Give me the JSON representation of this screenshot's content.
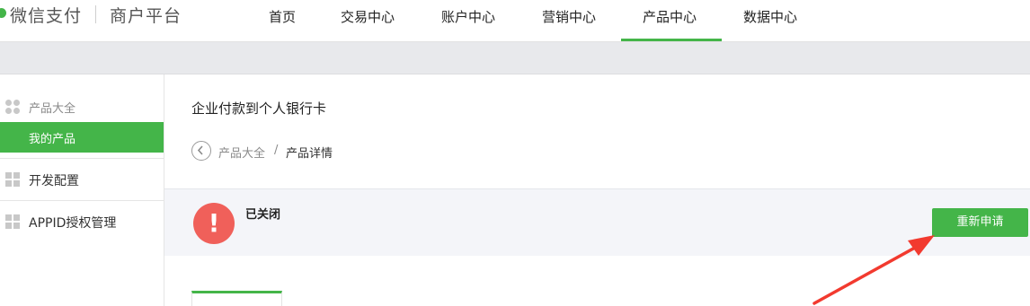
{
  "brand": {
    "name": "微信支付",
    "subtitle": "商户平台"
  },
  "nav": {
    "items": [
      {
        "label": "首页"
      },
      {
        "label": "交易中心"
      },
      {
        "label": "账户中心"
      },
      {
        "label": "营销中心"
      },
      {
        "label": "产品中心",
        "active": true
      },
      {
        "label": "数据中心"
      }
    ]
  },
  "sidebar": {
    "group_title": "产品大全",
    "active_item": "我的产品",
    "items": [
      {
        "label": "开发配置",
        "icon": "grid-icon"
      },
      {
        "label": "APPID授权管理",
        "icon": "grid-icon"
      }
    ]
  },
  "main": {
    "title": "企业付款到个人银行卡",
    "breadcrumb": {
      "parent": "产品大全",
      "separator": "/",
      "current": "产品详情"
    },
    "status": {
      "text": "已关闭",
      "icon": "exclamation-icon"
    },
    "reapply_label": "重新申请"
  },
  "colors": {
    "accent": "#44b549",
    "alert": "#f0605a",
    "annotation": "#f23a2f"
  }
}
